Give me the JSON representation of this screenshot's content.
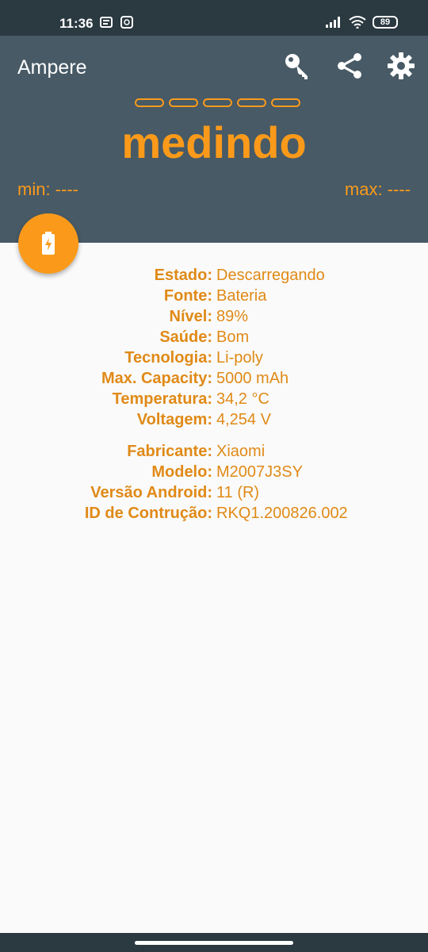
{
  "status_bar": {
    "time": "11:36",
    "battery_level": "89"
  },
  "app": {
    "title": "Ampere",
    "actions": [
      "key-icon",
      "share-icon",
      "settings-icon"
    ],
    "measure_state": "medindo",
    "min_label": "min: ----",
    "max_label": "max: ----",
    "accent": "#fb9a1a",
    "appbar_color": "#475a66"
  },
  "battery_info": [
    {
      "key": "Estado:",
      "value": "Descarregando"
    },
    {
      "key": "Fonte:",
      "value": "Bateria"
    },
    {
      "key": "Nível:",
      "value": "89%"
    },
    {
      "key": "Saúde:",
      "value": "Bom"
    },
    {
      "key": "Tecnologia:",
      "value": "Li-poly"
    },
    {
      "key": "Max. Capacity:",
      "value": "5000 mAh"
    },
    {
      "key": "Temperatura:",
      "value": "34,2 °C"
    },
    {
      "key": "Voltagem:",
      "value": "4,254 V"
    }
  ],
  "device_info": [
    {
      "key": "Fabricante:",
      "value": "Xiaomi"
    },
    {
      "key": "Modelo:",
      "value": "M2007J3SY"
    },
    {
      "key": "Versão Android:",
      "value": "11 (R)"
    },
    {
      "key": "ID de Contrução:",
      "value": "RKQ1.200826.002"
    }
  ]
}
